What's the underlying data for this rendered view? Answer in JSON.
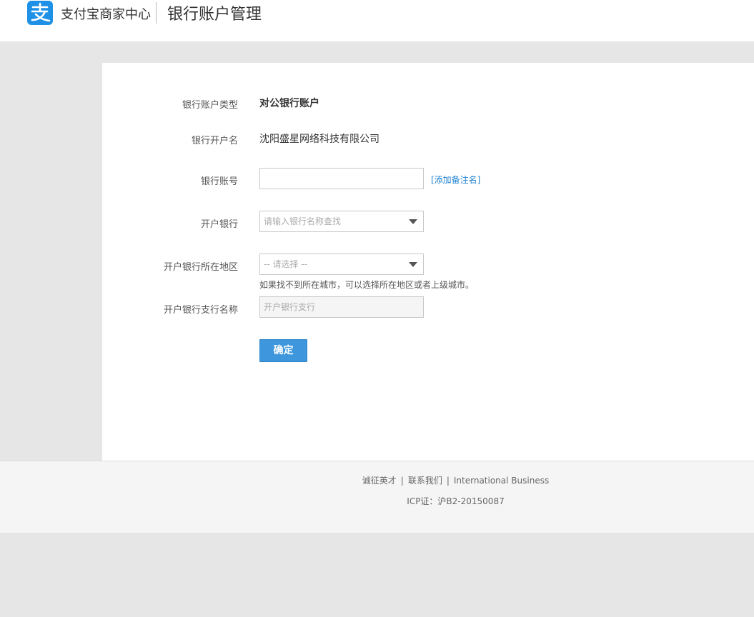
{
  "header": {
    "brand": "支付宝商家中心",
    "page_title": "银行账户管理",
    "logo_icon": "alipay-logo-icon",
    "brand_color": "#1e91e6"
  },
  "form": {
    "account_type": {
      "label": "银行账户类型",
      "value": "对公银行账户"
    },
    "account_name": {
      "label": "银行开户名",
      "value": "沈阳盛星网络科技有限公司"
    },
    "account_number": {
      "label": "银行账号",
      "value": "",
      "add_note_link": "[添加备注名]"
    },
    "bank": {
      "label": "开户银行",
      "placeholder": "请输入银行名称查找"
    },
    "region": {
      "label": "开户银行所在地区",
      "selected": "-- 请选择 --",
      "hint": "如果找不到所在城市，可以选择所在地区或者上级城市。"
    },
    "branch": {
      "label": "开户银行支行名称",
      "placeholder": "开户银行支行"
    },
    "submit_label": "确定",
    "button_color": "#3e97dc"
  },
  "footer": {
    "links": [
      "诚征英才",
      "联系我们",
      "International Business"
    ],
    "separator": "|",
    "icp": "ICP证：沪B2-20150087"
  }
}
